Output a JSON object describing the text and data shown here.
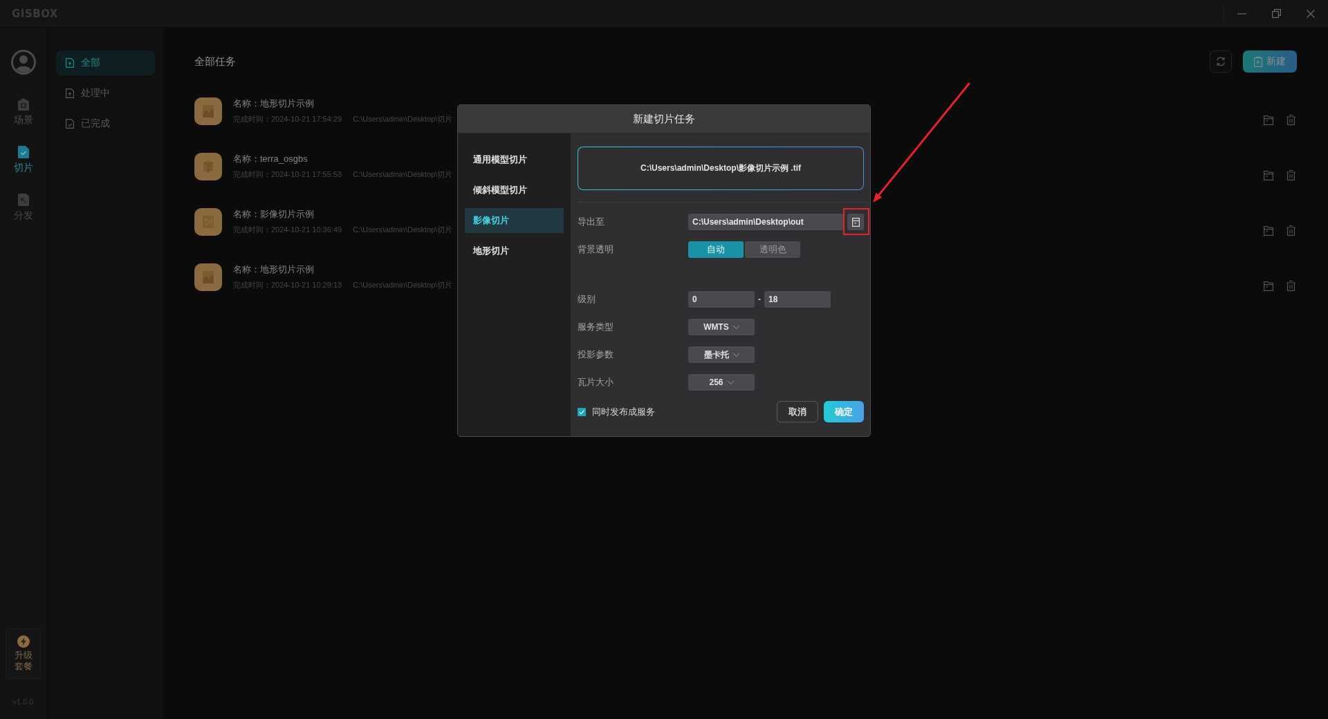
{
  "window": {
    "logo": "GISBOX"
  },
  "rail": {
    "items": [
      {
        "label": "场景",
        "selected": false
      },
      {
        "label": "切片",
        "selected": true
      },
      {
        "label": "分发",
        "selected": false
      }
    ],
    "upgrade": "升级套餐",
    "version": "v1.0.0"
  },
  "filters": [
    {
      "label": "全部",
      "selected": true
    },
    {
      "label": "处理中",
      "selected": false
    },
    {
      "label": "已完成",
      "selected": false
    }
  ],
  "main": {
    "title": "全部任务",
    "new_button": "新建"
  },
  "tasks": [
    {
      "kind": "terrain",
      "name": "名称：地形切片示例",
      "time": "完成时间：2024-10-21 17:54:29",
      "path": "C:\\Users\\admin\\Desktop\\切片"
    },
    {
      "kind": "model",
      "name": "名称：terra_osgbs",
      "time": "完成时间：2024-10-21 17:55:53",
      "path": "C:\\Users\\admin\\Desktop\\切片"
    },
    {
      "kind": "image",
      "name": "名称：影像切片示例",
      "time": "完成时间：2024-10-21 10:36:49",
      "path": "C:\\Users\\admin\\Desktop\\切片"
    },
    {
      "kind": "terrain",
      "name": "名称：地形切片示例",
      "time": "完成时间：2024-10-21 10:29:13",
      "path": "C:\\Users\\admin\\Desktop\\切片"
    }
  ],
  "dialog": {
    "title": "新建切片任务",
    "types": [
      {
        "label": "通用模型切片",
        "selected": false
      },
      {
        "label": "倾斜模型切片",
        "selected": false
      },
      {
        "label": "影像切片",
        "selected": true
      },
      {
        "label": "地形切片",
        "selected": false
      }
    ],
    "source_file": "C:\\Users\\admin\\Desktop\\影像切片示例 .tif",
    "fields": [
      {
        "kind": "path",
        "label": "导出至",
        "value": "C:\\Users\\admin\\Desktop\\out",
        "highlighted": true
      },
      {
        "kind": "toggle",
        "label": "背景透明",
        "options": [
          {
            "label": "自动",
            "selected": true
          },
          {
            "label": "透明色",
            "selected": false
          }
        ]
      },
      {
        "kind": "range",
        "label": "级别",
        "from": "0",
        "separator": "-",
        "to": "18"
      },
      {
        "kind": "select",
        "label": "服务类型",
        "value": "WMTS"
      },
      {
        "kind": "select",
        "label": "投影参数",
        "value": "墨卡托"
      },
      {
        "kind": "select",
        "label": "瓦片大小",
        "value": "256"
      }
    ],
    "publish": {
      "label": "同时发布成服务",
      "checked": true
    },
    "buttons": [
      {
        "kind": "secondary",
        "label": "取消"
      },
      {
        "kind": "primary",
        "label": "确定"
      }
    ]
  }
}
